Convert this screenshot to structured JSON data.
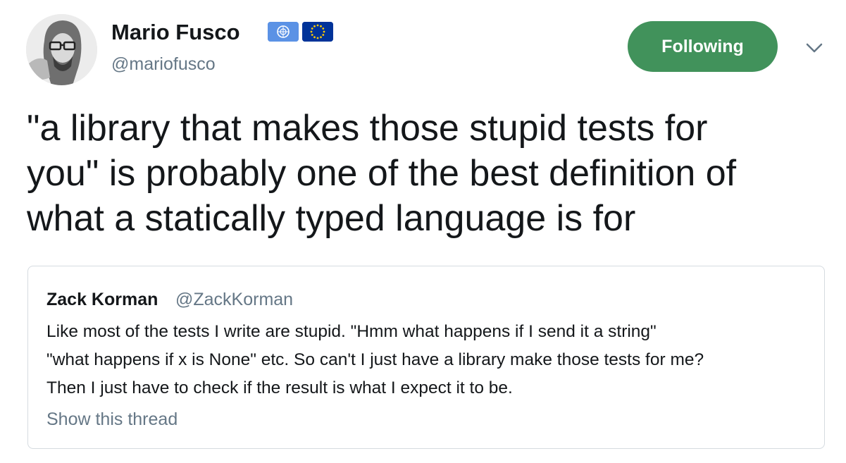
{
  "author": {
    "name": "Mario Fusco",
    "handle": "@mariofusco",
    "flags": [
      "un-flag-icon",
      "eu-flag-icon"
    ]
  },
  "follow_button": {
    "label": "Following",
    "color": "#41925b"
  },
  "more_menu": {
    "icon": "chevron-down-icon"
  },
  "tweet": {
    "text": "\"a library that makes those stupid tests for\nyou\" is probably one of the best definition of\nwhat a statically typed language is for"
  },
  "quoted_tweet": {
    "name": "Zack Korman",
    "handle": "@ZackKorman",
    "text": "Like most of the tests I write are stupid. \"Hmm what happens if I send it a string\"\n\"what happens if x is None\" etc. So can't I just have a library make those tests for me?\nThen I just have to check if the result is what I expect it to be.",
    "show_thread_label": "Show this thread"
  },
  "colors": {
    "text_primary": "#14171a",
    "text_secondary": "#657786",
    "border": "#d5dbe0"
  }
}
